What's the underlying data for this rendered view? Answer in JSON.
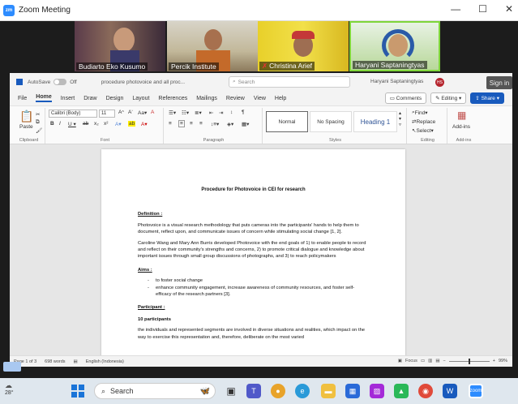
{
  "zoom": {
    "title": "Zoom Meeting",
    "logo": "zm",
    "controls": [
      "—",
      "☐",
      "✕"
    ]
  },
  "participants": [
    {
      "name": "Budiarto Eko Kusumo",
      "muted": false
    },
    {
      "name": "Percik Institute",
      "muted": false
    },
    {
      "name": "Christina Arief",
      "muted": true
    },
    {
      "name": "Haryani Saptaningtyas",
      "muted": false
    }
  ],
  "word": {
    "autosave_label": "AutoSave",
    "autosave_state": "Off",
    "doc_title": "procedure photovoice and all proc...",
    "search_placeholder": "Search",
    "user_name": "Haryani Saptaningtyas",
    "user_initials": "HS",
    "signin": "Sign in",
    "menu": [
      "File",
      "Home",
      "Insert",
      "Draw",
      "Design",
      "Layout",
      "References",
      "Mailings",
      "Review",
      "View",
      "Help"
    ],
    "active_menu": "Home",
    "comments_label": "Comments",
    "editing_label": "Editing",
    "share_label": "Share",
    "ribbon": {
      "paste": "Paste",
      "clipboard": "Clipboard",
      "font_name": "Calibri (Body)",
      "font_size": "11",
      "font_group": "Font",
      "paragraph_group": "Paragraph",
      "styles_group": "Styles",
      "editing_group": "Editing",
      "addins_group": "Add-ins",
      "styles": [
        "Normal",
        "No Spacing",
        "Heading 1"
      ],
      "find": "Find",
      "replace": "Replace",
      "select": "Select",
      "addins": "Add-ins"
    },
    "document": {
      "title": "Procedure for Photovoice in CEI for research",
      "definition_heading": "Definition :",
      "definition_p1": "Photovoice is a visual research methodology that puts cameras into the participants' hands to help them to document, reflect upon, and communicate issues of concern while stimulating social change [1, 2].",
      "definition_p2": "Caroline Wang and Mary Ann Burris developed Photovoice with the end goals of 1) to enable people to record and reflect on their community's strengths and concerns, 2) to promote critical dialogue and knowledge about important issues through small group discussions of photographs, and 3) to reach policymakers",
      "aims_heading": "Aims :",
      "aims": [
        "to foster social change",
        "enhance community engagement, increase awareness of community resources, and foster self-efficacy of the research partners [3]."
      ],
      "participant_heading": "Participant :",
      "participant_count": "10 participants",
      "participant_p": "the individuals and represented segments are involved in diverse situations and realities, which impact on the way to exercise this representation and, therefore, deliberate on the most varied"
    },
    "status": {
      "page": "Page 1 of 3",
      "words": "698 words",
      "language": "English (Indonesia)",
      "focus": "Focus",
      "zoom": "99%"
    }
  },
  "taskbar": {
    "temperature": "28°",
    "search_label": "Search"
  },
  "colors": {
    "word_blue": "#185abd",
    "zoom_blue": "#2d8cff",
    "muted_red": "#e33333"
  }
}
